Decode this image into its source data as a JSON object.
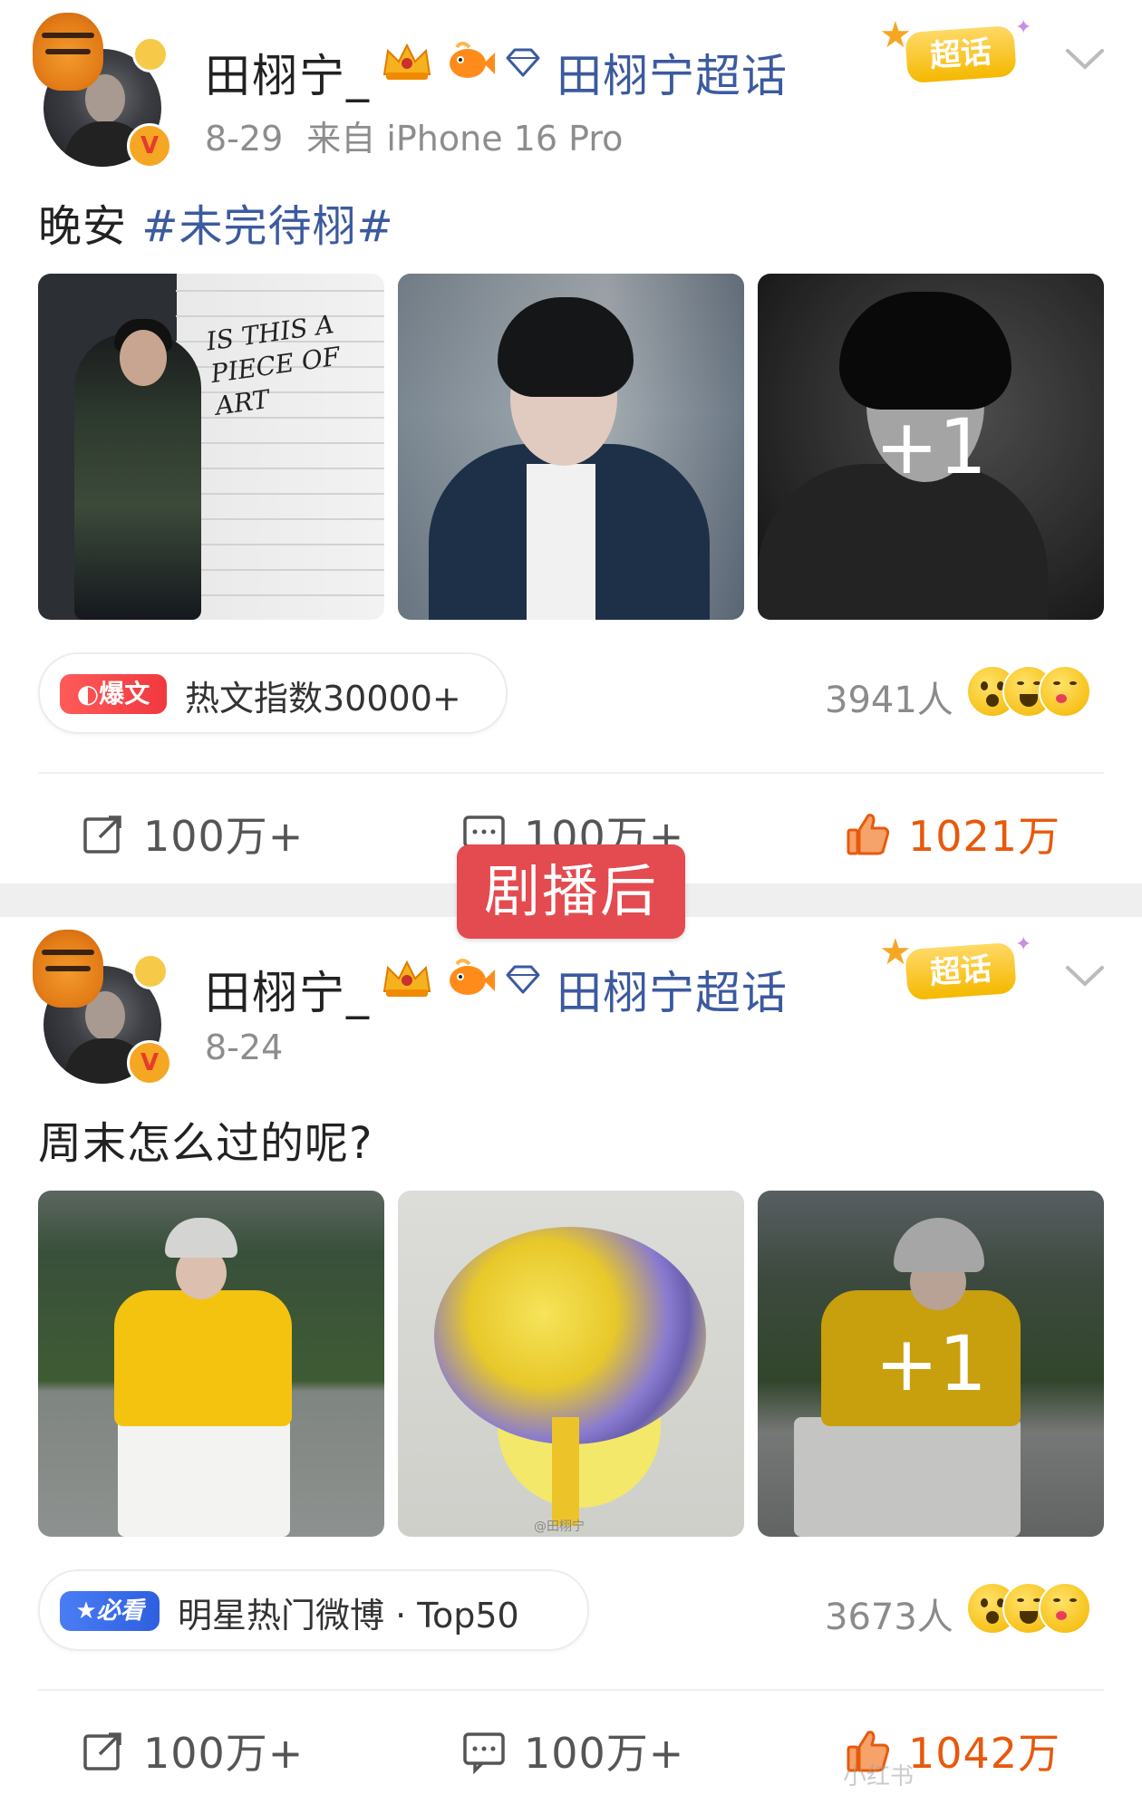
{
  "overlay_label": "剧播后",
  "posts": [
    {
      "username": "田栩宁_",
      "supertopic": "田栩宁超话",
      "chaohua_label": "超话",
      "date": "8-29",
      "source": "来自 iPhone 16 Pro",
      "text": "晚安 ",
      "hashtag": "#未完待栩#",
      "photos_more": "+1",
      "badge_tag": "爆文",
      "badge_text": "热文指数30000+",
      "reactors": "3941人",
      "actions": {
        "repost": "100万+",
        "comment": "100万+",
        "like": "1021万"
      }
    },
    {
      "username": "田栩宁_",
      "supertopic": "田栩宁超话",
      "chaohua_label": "超话",
      "date": "8-24",
      "source": "",
      "text": "周末怎么过的呢?",
      "hashtag": "",
      "photos_more": "+1",
      "badge_tag": "必看",
      "badge_text": "明星热门微博 · Top50",
      "reactors": "3673人",
      "actions": {
        "repost": "100万+",
        "comment": "100万+",
        "like": "1042万"
      }
    }
  ],
  "photo_caption_1": "IS THIS A PIECE OF ART",
  "photo_watermark_2": "@田栩宁",
  "watermark": "小红书",
  "colors": {
    "link": "#3b5a9f",
    "like": "#e8590c",
    "overlay": "#e34b50"
  },
  "icons": [
    "verified-icon",
    "crown-icon",
    "fish-icon",
    "diamond-icon",
    "chevron-down-icon",
    "repost-icon",
    "comment-icon",
    "like-icon"
  ]
}
